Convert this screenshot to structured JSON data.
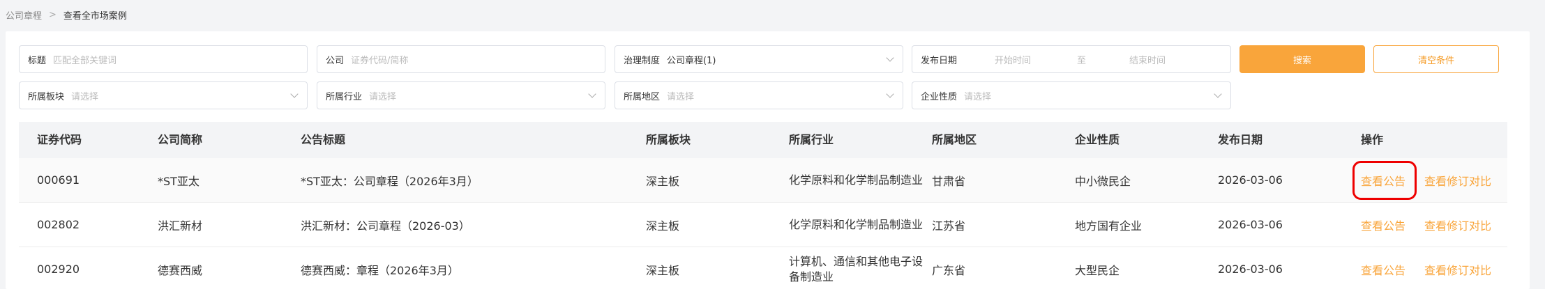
{
  "breadcrumb": {
    "parent": "公司章程",
    "separator": ">",
    "current": "查看全市场案例"
  },
  "filters": {
    "title": {
      "label": "标题",
      "placeholder": "匹配全部关键词"
    },
    "company": {
      "label": "公司",
      "placeholder": "证券代码/简称"
    },
    "governance": {
      "label": "治理制度",
      "value": "公司章程(1)"
    },
    "publish_date": {
      "label": "发布日期",
      "start_placeholder": "开始时间",
      "to": "至",
      "end_placeholder": "结束时间"
    },
    "board": {
      "label": "所属板块",
      "placeholder": "请选择"
    },
    "industry": {
      "label": "所属行业",
      "placeholder": "请选择"
    },
    "region": {
      "label": "所属地区",
      "placeholder": "请选择"
    },
    "nature": {
      "label": "企业性质",
      "placeholder": "请选择"
    }
  },
  "actions": {
    "search": "搜索",
    "clear": "清空条件"
  },
  "table": {
    "headers": [
      "证券代码",
      "公司简称",
      "公告标题",
      "所属板块",
      "所属行业",
      "所属地区",
      "企业性质",
      "发布日期",
      "操作"
    ],
    "rows": [
      {
        "code": "000691",
        "name": "*ST亚太",
        "title": "*ST亚太：公司章程（2026年3月）",
        "board": "深主板",
        "industry": "化学原料和化学制品制造业",
        "region": "甘肃省",
        "nature": "中小微民企",
        "date": "2026-03-06",
        "view": "查看公告",
        "compare": "查看修订对比"
      },
      {
        "code": "002802",
        "name": "洪汇新材",
        "title": "洪汇新材：公司章程（2026-03）",
        "board": "深主板",
        "industry": "化学原料和化学制品制造业",
        "region": "江苏省",
        "nature": "地方国有企业",
        "date": "2026-03-06",
        "view": "查看公告",
        "compare": "查看修订对比"
      },
      {
        "code": "002920",
        "name": "德赛西威",
        "title": "德赛西威：章程（2026年3月）",
        "board": "深主板",
        "industry": "计算机、通信和其他电子设备制造业",
        "region": "广东省",
        "nature": "大型民企",
        "date": "2026-03-06",
        "view": "查看公告",
        "compare": "查看修订对比"
      }
    ]
  },
  "colors": {
    "accent": "#f9a53b",
    "highlight": "#ee0000"
  }
}
